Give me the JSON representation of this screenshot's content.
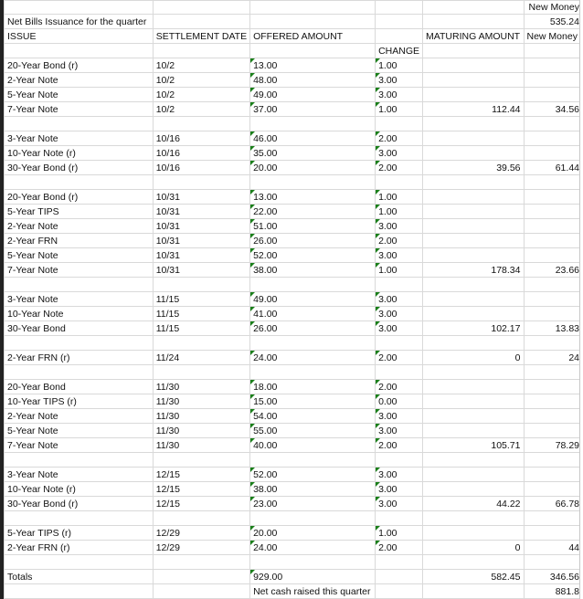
{
  "header": {
    "new_money_label_top": "New Money",
    "title": "Net Bills  Issuance for the quarter",
    "net_bills_value": "535.24",
    "col_issue": "ISSUE",
    "col_settlement": "SETTLEMENT DATE",
    "col_offered": "OFFERED AMOUNT",
    "col_change": "CHANGE",
    "col_maturing": "MATURING AMOUNT",
    "col_new_money": "New Money"
  },
  "rows": [
    [
      "20-Year Bond (r)",
      "10/2",
      "13.00",
      "1.00",
      "",
      ""
    ],
    [
      "2-Year Note",
      "10/2",
      "48.00",
      "3.00",
      "",
      ""
    ],
    [
      "5-Year Note",
      "10/2",
      "49.00",
      "3.00",
      "",
      ""
    ],
    [
      "7-Year Note",
      "10/2",
      "37.00",
      "1.00",
      "112.44",
      "34.56"
    ],
    null,
    [
      "3-Year Note",
      "10/16",
      "46.00",
      "2.00",
      "",
      ""
    ],
    [
      "10-Year Note (r)",
      "10/16",
      "35.00",
      "3.00",
      "",
      ""
    ],
    [
      "30-Year Bond (r)",
      "10/16",
      "20.00",
      "2.00",
      "39.56",
      "61.44"
    ],
    null,
    [
      "20-Year Bond (r)",
      "10/31",
      "13.00",
      "1.00",
      "",
      ""
    ],
    [
      "5-Year TIPS",
      "10/31",
      "22.00",
      "1.00",
      "",
      ""
    ],
    [
      "2-Year Note",
      "10/31",
      "51.00",
      "3.00",
      "",
      ""
    ],
    [
      "2-Year FRN",
      "10/31",
      "26.00",
      "2.00",
      "",
      ""
    ],
    [
      "5-Year Note",
      "10/31",
      "52.00",
      "3.00",
      "",
      ""
    ],
    [
      "7-Year Note",
      "10/31",
      "38.00",
      "1.00",
      "178.34",
      "23.66"
    ],
    null,
    [
      "3-Year Note",
      "11/15",
      "49.00",
      "3.00",
      "",
      ""
    ],
    [
      "10-Year Note",
      "11/15",
      "41.00",
      "3.00",
      "",
      ""
    ],
    [
      "30-Year Bond",
      "11/15",
      "26.00",
      "3.00",
      "102.17",
      "13.83"
    ],
    null,
    [
      "2-Year FRN (r)",
      "11/24",
      "24.00",
      "2.00",
      "0",
      "24"
    ],
    null,
    [
      "20-Year Bond",
      "11/30",
      "18.00",
      "2.00",
      "",
      ""
    ],
    [
      "10-Year TIPS (r)",
      "11/30",
      "15.00",
      "0.00",
      "",
      ""
    ],
    [
      "2-Year Note",
      "11/30",
      "54.00",
      "3.00",
      "",
      ""
    ],
    [
      "5-Year Note",
      "11/30",
      "55.00",
      "3.00",
      "",
      ""
    ],
    [
      "7-Year Note",
      "11/30",
      "40.00",
      "2.00",
      "105.71",
      "78.29"
    ],
    null,
    [
      "3-Year Note",
      "12/15",
      "52.00",
      "3.00",
      "",
      ""
    ],
    [
      "10-Year Note (r)",
      "12/15",
      "38.00",
      "3.00",
      "",
      ""
    ],
    [
      "30-Year Bond (r)",
      "12/15",
      "23.00",
      "3.00",
      "44.22",
      "66.78"
    ],
    null,
    [
      "5-Year TIPS (r)",
      "12/29",
      "20.00",
      "1.00",
      "",
      ""
    ],
    [
      "2-Year FRN (r)",
      "12/29",
      "24.00",
      "2.00",
      "0",
      "44"
    ],
    null
  ],
  "totals": {
    "label": "Totals",
    "offered": "929.00",
    "maturing": "582.45",
    "new_money": "346.56",
    "net_cash_label": "Net cash raised this quarter",
    "net_cash_value": "881.8"
  }
}
